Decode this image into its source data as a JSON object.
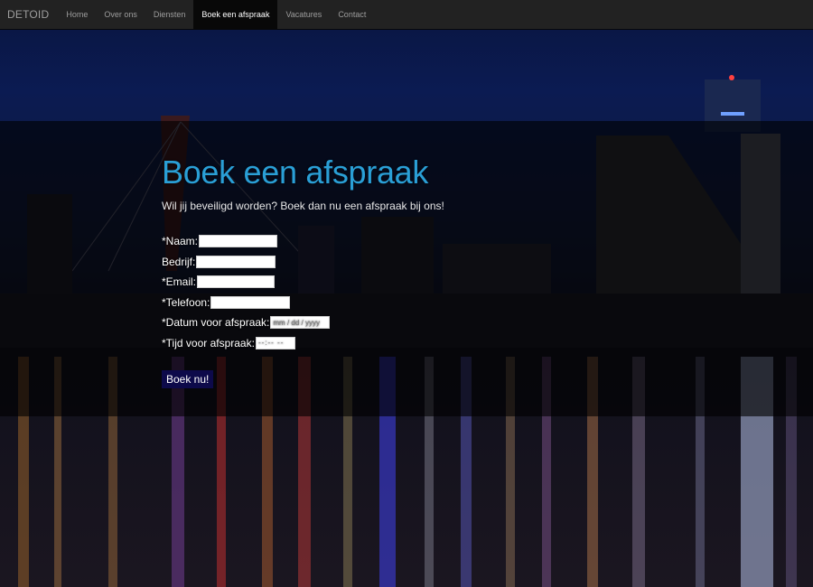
{
  "nav": {
    "brand": "DETOID",
    "items": [
      {
        "label": "Home",
        "active": false
      },
      {
        "label": "Over ons",
        "active": false
      },
      {
        "label": "Diensten",
        "active": false
      },
      {
        "label": "Boek een afspraak",
        "active": true
      },
      {
        "label": "Vacatures",
        "active": false
      },
      {
        "label": "Contact",
        "active": false
      }
    ]
  },
  "main": {
    "title": "Boek een afspraak",
    "intro": "Wil jij beveiligd worden? Boek dan nu een afspraak bij ons!"
  },
  "form": {
    "naam_label": "*Naam:",
    "bedrijf_label": "Bedrijf:",
    "email_label": "*Email:",
    "telefoon_label": "*Telefoon:",
    "datum_label": "*Datum voor afspraak:",
    "datum_placeholder": "mm / dd / yyyy",
    "tijd_label": "*Tijd voor afspraak:",
    "tijd_placeholder": "--:-- --",
    "submit_label": "Boek nu!"
  },
  "colors": {
    "navbar": "#222222",
    "title": "#2a9fd6",
    "button": "#0d0a4a"
  }
}
